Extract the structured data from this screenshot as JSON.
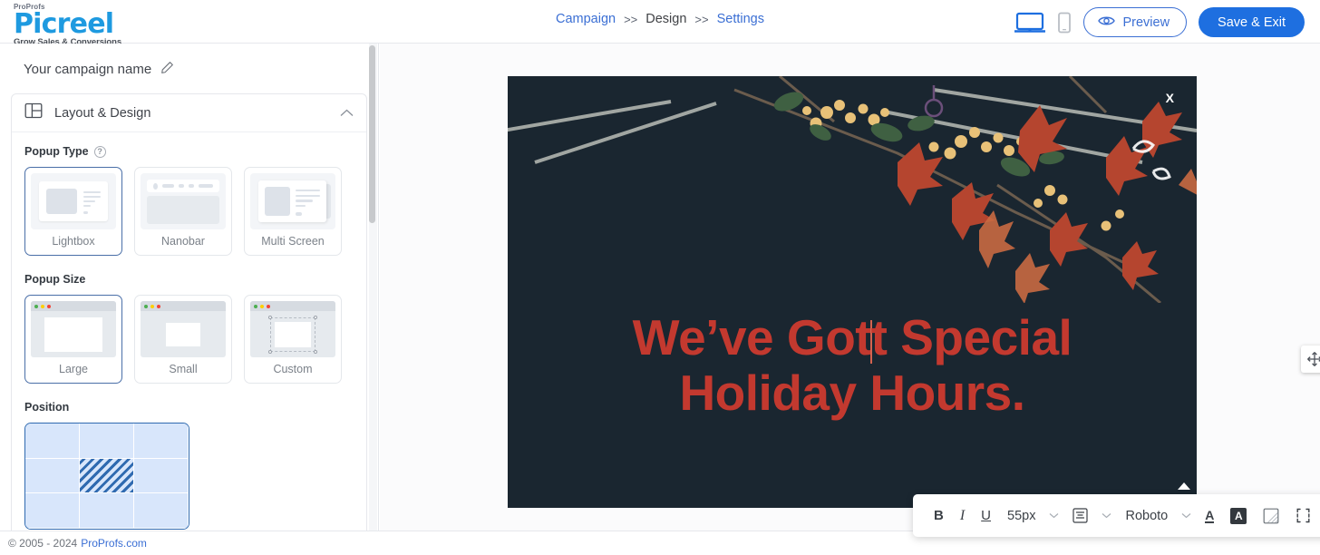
{
  "header": {
    "logo": {
      "top": "ProProfs",
      "main": "Picreel",
      "tagline": "Grow Sales & Conversions"
    },
    "breadcrumb": [
      {
        "label": "Campaign",
        "active": false
      },
      {
        "sep": ">>"
      },
      {
        "label": "Design",
        "active": true
      },
      {
        "sep": ">>"
      },
      {
        "label": "Settings",
        "active": false
      }
    ],
    "breadcrumb_items": [
      "Campaign",
      "Design",
      "Settings"
    ],
    "sep1": ">>",
    "sep2": ">>",
    "device_desktop": "desktop-view-icon",
    "device_mobile": "mobile-view-icon",
    "preview_label": "Preview",
    "save_label": "Save & Exit",
    "accent_blue": "#1e6fe0",
    "link_blue": "#3b6fd4"
  },
  "sidebar": {
    "campaign_name": "Your campaign name",
    "edit_icon": "pencil-icon",
    "panel": {
      "title": "Layout & Design",
      "icon": "layout-icon",
      "chevron": "chevron-up-icon"
    },
    "popup_type": {
      "label": "Popup Type",
      "help": "?",
      "options": [
        {
          "label": "Lightbox",
          "selected": true
        },
        {
          "label": "Nanobar",
          "selected": false
        },
        {
          "label": "Multi Screen",
          "selected": false
        }
      ]
    },
    "popup_size": {
      "label": "Popup Size",
      "options": [
        {
          "label": "Large",
          "selected": true
        },
        {
          "label": "Small",
          "selected": false
        },
        {
          "label": "Custom",
          "selected": false
        }
      ]
    },
    "position": {
      "label": "Position",
      "selected_cell": 4,
      "cells": [
        0,
        1,
        2,
        3,
        4,
        5,
        6,
        7,
        8
      ]
    }
  },
  "popup": {
    "close_label": "X",
    "headline_part1": "We’ve Got",
    "headline_part2": "t Special",
    "headline_line2": "Holiday Hours.",
    "headline_color": "#c3392f",
    "background_color": "#1a2630",
    "move_handle": "move-handle-icon"
  },
  "toolbar": {
    "bold": "B",
    "italic": "I",
    "underline": "U",
    "font_size": "55px",
    "align_icon": "align-center-icon",
    "font_family": "Roboto",
    "text_color_icon": "A",
    "bg_color_icon": "A",
    "gradient_icon": "opacity-gradient-icon",
    "border_icon": "border-brackets-icon",
    "reset_icon": "reset-icon",
    "delete_icon": "trash-icon",
    "chevron": "▾"
  },
  "footer": {
    "copyright": "© 2005 - 2024",
    "link": "ProProfs.com"
  }
}
